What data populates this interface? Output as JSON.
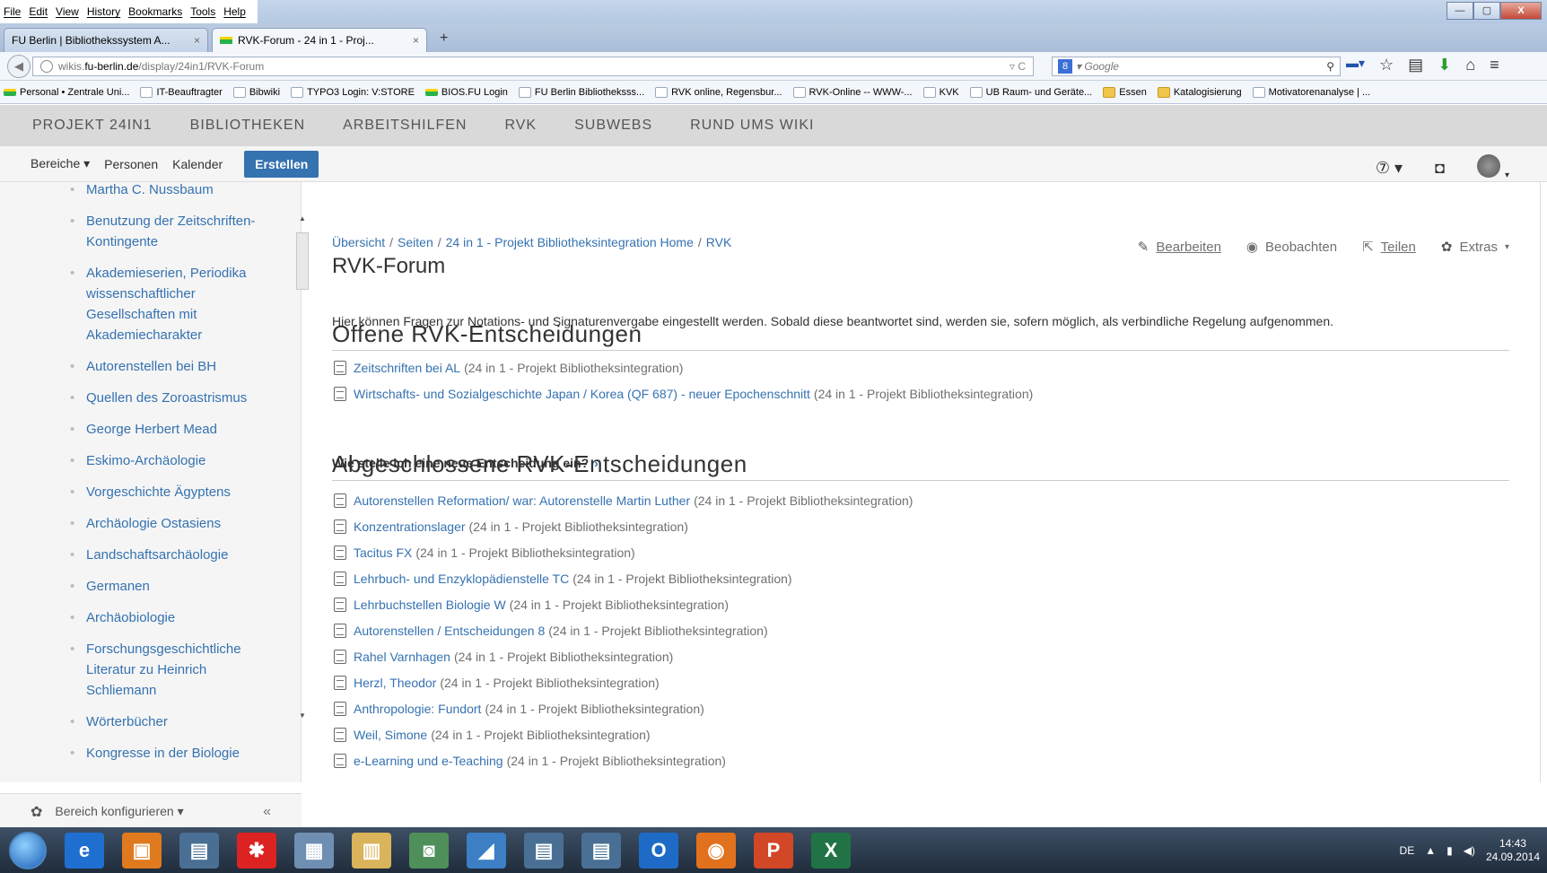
{
  "browser": {
    "menu": [
      "File",
      "Edit",
      "View",
      "History",
      "Bookmarks",
      "Tools",
      "Help"
    ],
    "tabs": [
      {
        "label": "FU Berlin | Bibliothekssystem A...",
        "close": "×"
      },
      {
        "label": "RVK-Forum - 24 in 1 - Proj...",
        "close": "×"
      }
    ],
    "new_tab": "+",
    "url_prefix": "wikis.",
    "url_domain": "fu-berlin.de",
    "url_path": "/display/24in1/RVK-Forum",
    "url_right": "▿ C",
    "search_engine_badge": "8",
    "search_placeholder": "▾ Google",
    "search_icon": "⚲",
    "window_controls": {
      "minimize": "—",
      "maximize": "▢",
      "close": "X"
    },
    "bookmarks": [
      {
        "label": "Personal • Zentrale Uni...",
        "icon": "green"
      },
      {
        "label": "IT-Beauftragter",
        "icon": "page"
      },
      {
        "label": "Bibwiki",
        "icon": "page"
      },
      {
        "label": "TYPO3 Login: V:STORE",
        "icon": "page"
      },
      {
        "label": "BIOS.FU Login",
        "icon": "green"
      },
      {
        "label": "FU Berlin  Bibliotheksss...",
        "icon": "page"
      },
      {
        "label": "RVK online, Regensbur...",
        "icon": "page"
      },
      {
        "label": "RVK-Online -- WWW-...",
        "icon": "page"
      },
      {
        "label": "KVK",
        "icon": "page"
      },
      {
        "label": "UB Raum- und Geräte...",
        "icon": "page"
      },
      {
        "label": "Essen",
        "icon": "folder"
      },
      {
        "label": "Katalogisierung",
        "icon": "folder"
      },
      {
        "label": "Motivatorenanalyse | ...",
        "icon": "page"
      }
    ]
  },
  "space_nav": [
    "PROJEKT 24IN1",
    "BIBLIOTHEKEN",
    "ARBEITSHILFEN",
    "RVK",
    "SUBWEBS",
    "RUND UMS WIKI"
  ],
  "header": {
    "bereiche": "Bereiche ▾",
    "personen": "Personen",
    "kalender": "Kalender",
    "erstellen": "Erstellen",
    "help": "⑦ ▾",
    "notifications": "◘"
  },
  "sidebar": {
    "items": [
      {
        "label": "Martha C. Nussbaum",
        "lines": 1
      },
      {
        "label": "Benutzung der Zeitschriften-Kontingente",
        "lines": 2
      },
      {
        "label": "Akademieserien, Periodika wissenschaftlicher Gesellschaften mit Akademiecharakter",
        "lines": 4
      },
      {
        "label": "Autorenstellen bei BH",
        "lines": 1
      },
      {
        "label": "Quellen des Zoroastrismus",
        "lines": 1
      },
      {
        "label": "George Herbert Mead",
        "lines": 1
      },
      {
        "label": "Eskimo-Archäologie",
        "lines": 1
      },
      {
        "label": "Vorgeschichte Ägyptens",
        "lines": 1
      },
      {
        "label": "Archäologie Ostasiens",
        "lines": 1
      },
      {
        "label": "Landschaftsarchäologie",
        "lines": 1
      },
      {
        "label": "Germanen",
        "lines": 1
      },
      {
        "label": "Archäobiologie",
        "lines": 1
      },
      {
        "label": "Forschungsgeschichtliche Literatur zu Heinrich Schliemann",
        "lines": 3
      },
      {
        "label": "Wörterbücher",
        "lines": 1
      },
      {
        "label": "Kongresse in der Biologie",
        "lines": 1
      }
    ],
    "footer_label": "Bereich konfigurieren ▾",
    "collapse": "«"
  },
  "main": {
    "breadcrumb": [
      "Übersicht",
      "Seiten",
      "24 in 1 - Projekt Bibliotheksintegration Home",
      "RVK"
    ],
    "breadcrumb_sep": "/",
    "title": "RVK-Forum",
    "actions": {
      "edit": "Bearbeiten",
      "watch": "Beobachten",
      "share": "Teilen",
      "extras": "Extras"
    },
    "intro": "Hier können Fragen zur Notations- und Signaturenvergabe eingestellt werden. Sobald diese beantwortet sind, werden sie, sofern möglich, als verbindliche Regelung aufgenommen.",
    "open_heading": "Offene RVK-Entscheidungen",
    "open_pages": [
      {
        "title": "Zeitschriften bei AL",
        "space": "(24 in 1 - Projekt Bibliotheksintegration)"
      },
      {
        "title": "Wirtschafts- und Sozialgeschichte Japan / Korea (QF 687) - neuer Epochenschnitt",
        "space": "(24 in 1 - Projekt Bibliotheksintegration)"
      }
    ],
    "howto": "Wie stelle ich eine neue Entscheidung ein?",
    "howto_chevron": "›",
    "closed_heading": "Abgeschlossene RVK-Entscheidungen",
    "closed_pages": [
      {
        "title": "Autorenstellen Reformation/ war: Autorenstelle Martin Luther",
        "space": "(24 in 1 - Projekt Bibliotheksintegration)"
      },
      {
        "title": "Konzentrationslager",
        "space": "(24 in 1 - Projekt Bibliotheksintegration)"
      },
      {
        "title": "Tacitus FX",
        "space": "(24 in 1 - Projekt Bibliotheksintegration)"
      },
      {
        "title": "Lehrbuch- und Enzyklopädienstelle TC",
        "space": "(24 in 1 - Projekt Bibliotheksintegration)"
      },
      {
        "title": "Lehrbuchstellen Biologie W",
        "space": "(24 in 1 - Projekt Bibliotheksintegration)"
      },
      {
        "title": "Autorenstellen / Entscheidungen 8",
        "space": "(24 in 1 - Projekt Bibliotheksintegration)"
      },
      {
        "title": "Rahel Varnhagen",
        "space": "(24 in 1 - Projekt Bibliotheksintegration)"
      },
      {
        "title": "Herzl, Theodor",
        "space": "(24 in 1 - Projekt Bibliotheksintegration)"
      },
      {
        "title": "Anthropologie: Fundort",
        "space": "(24 in 1 - Projekt Bibliotheksintegration)"
      },
      {
        "title": "Weil, Simone",
        "space": "(24 in 1 - Projekt Bibliotheksintegration)"
      },
      {
        "title": "e-Learning und e-Teaching",
        "space": "(24 in 1 - Projekt Bibliotheksintegration)"
      }
    ]
  },
  "taskbar": {
    "apps": [
      {
        "name": "internet-explorer",
        "glyph": "e",
        "color": "#1f6fd1"
      },
      {
        "name": "app-orange",
        "glyph": "▣",
        "color": "#e07a1f"
      },
      {
        "name": "app-window",
        "glyph": "▤",
        "color": "#4a6f94"
      },
      {
        "name": "app-red",
        "glyph": "✱",
        "color": "#d22"
      },
      {
        "name": "calculator",
        "glyph": "▦",
        "color": "#6f8fb2"
      },
      {
        "name": "explorer",
        "glyph": "▥",
        "color": "#d9b45a"
      },
      {
        "name": "app-green",
        "glyph": "◙",
        "color": "#4f8f5a"
      },
      {
        "name": "app-blue",
        "glyph": "◢",
        "color": "#3c7fc4"
      },
      {
        "name": "app-window-2",
        "glyph": "▤",
        "color": "#4a6f94"
      },
      {
        "name": "app-window-3",
        "glyph": "▤",
        "color": "#4a6f94"
      },
      {
        "name": "outlook",
        "glyph": "O",
        "color": "#1e6bc7"
      },
      {
        "name": "firefox",
        "glyph": "◉",
        "color": "#e2711d"
      },
      {
        "name": "powerpoint",
        "glyph": "P",
        "color": "#d24726"
      },
      {
        "name": "excel",
        "glyph": "X",
        "color": "#217346"
      }
    ],
    "lang": "DE",
    "time": "14:43",
    "date": "24.09.2014"
  }
}
